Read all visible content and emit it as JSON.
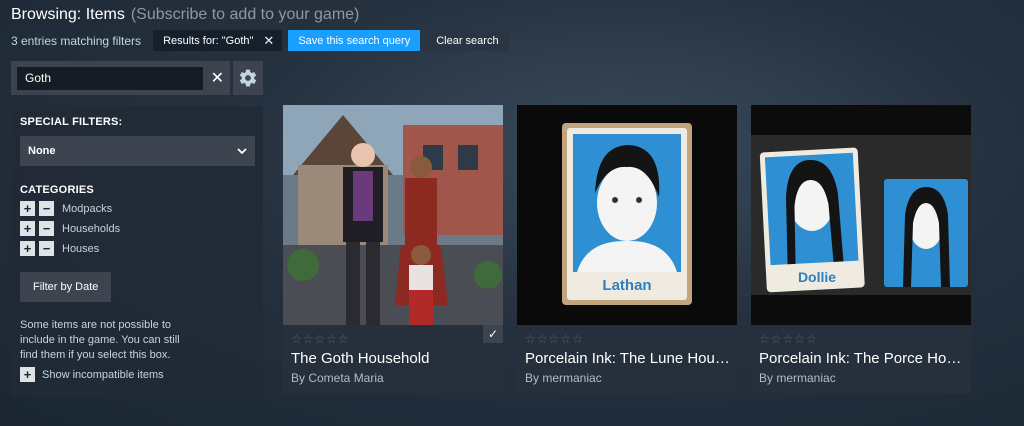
{
  "header": {
    "title": "Browsing: Items",
    "subtitle": "(Subscribe to add to your game)"
  },
  "toolbar": {
    "match_count": "3 entries matching filters",
    "chip_label": "Results for: \"Goth\"",
    "chip_close": "✕",
    "save_label": "Save this search query",
    "clear_label": "Clear search"
  },
  "search": {
    "value": "Goth",
    "clear": "✕"
  },
  "sidebar": {
    "special_filters_label": "SPECIAL FILTERS:",
    "special_filter_value": "None",
    "categories_label": "CATEGORIES",
    "categories": [
      {
        "label": "Modpacks"
      },
      {
        "label": "Households"
      },
      {
        "label": "Houses"
      }
    ],
    "filter_date_label": "Filter by Date",
    "note": "Some items are not possible to include in the game. You can still find them if you select this box.",
    "show_incompatible": "Show incompatible items"
  },
  "items": [
    {
      "name": "The Goth Household",
      "author": "By Cometa Maria",
      "rating": "☆☆☆☆☆",
      "subscribed": true
    },
    {
      "name": "Porcelain Ink: The Lune Household",
      "author": "By mermaniac",
      "rating": "☆☆☆☆☆",
      "subscribed": false,
      "portrait_label": "Lathan"
    },
    {
      "name": "Porcelain Ink: The Porce Household",
      "author": "By mermaniac",
      "rating": "☆☆☆☆☆",
      "subscribed": false,
      "portrait_label": "Dollie"
    }
  ],
  "colors": {
    "accent_blue": "#1a9fff",
    "panel": "#3d4450",
    "card": "#26303d"
  }
}
